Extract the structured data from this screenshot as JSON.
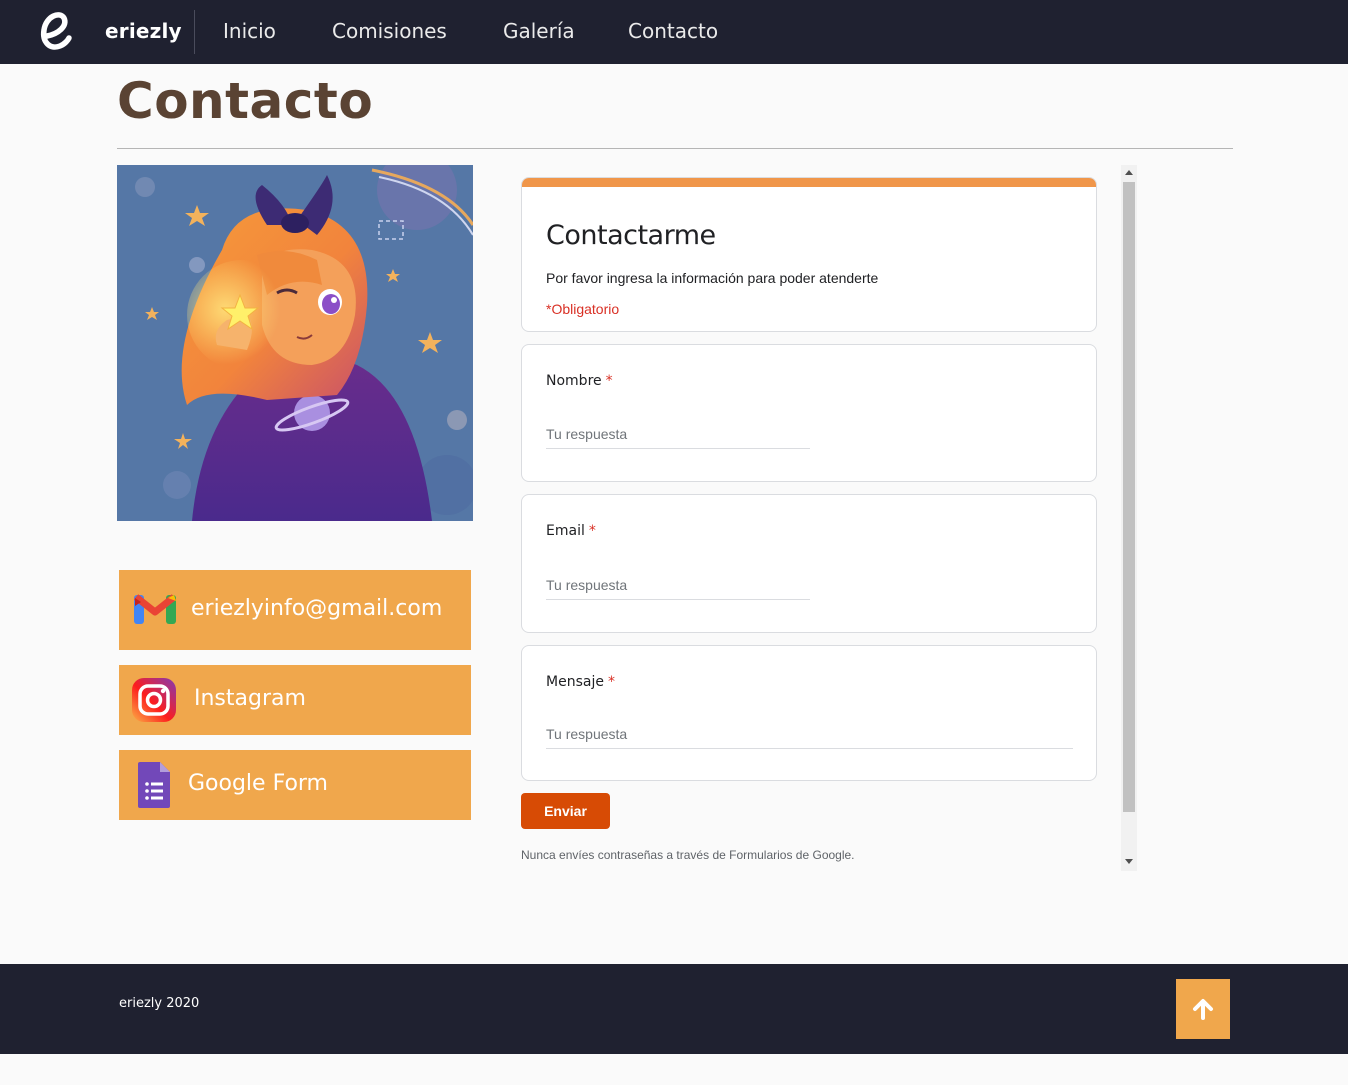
{
  "nav": {
    "logo_letter": "e",
    "brand": "eriezly",
    "links": [
      "Inicio",
      "Comisiones",
      "Galería",
      "Contacto"
    ]
  },
  "page": {
    "title": "Contacto"
  },
  "contacts": {
    "email": {
      "label": "eriezlyinfo@gmail.com",
      "icon": "gmail-icon"
    },
    "instagram": {
      "label": "Instagram",
      "icon": "instagram-icon"
    },
    "google_form": {
      "label": "Google Form",
      "icon": "google-forms-icon"
    }
  },
  "form": {
    "title": "Contactarme",
    "description": "Por favor ingresa la información para poder atenderte",
    "required_note": "*Obligatorio",
    "required_marker": "*",
    "questions": [
      {
        "label": "Nombre",
        "placeholder": "Tu respuesta"
      },
      {
        "label": "Email",
        "placeholder": "Tu respuesta"
      },
      {
        "label": "Mensaje",
        "placeholder": "Tu respuesta"
      }
    ],
    "submit_label": "Enviar",
    "footer_note": "Nunca envíes contraseñas a través de Formularios de Google."
  },
  "footer": {
    "copyright": "eriezly 2020",
    "back_to_top_icon": "arrow-up-icon"
  },
  "colors": {
    "navbar_bg": "#1f2130",
    "accent_orange": "#f0a74c",
    "title_brown": "#5a4333",
    "form_accent": "#f0964a",
    "submit_bg": "#d74b05",
    "required_red": "#d93025"
  }
}
